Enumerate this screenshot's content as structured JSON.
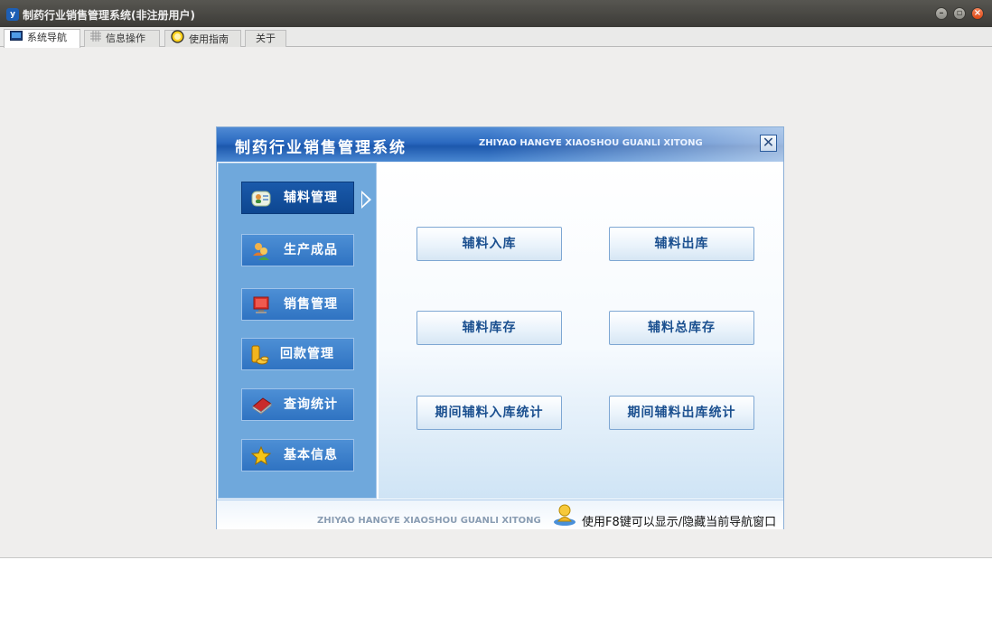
{
  "window": {
    "title": "制药行业销售管理系统(非注册用户)",
    "app_icon_text": "y",
    "controls": [
      "minimize",
      "maximize",
      "close"
    ]
  },
  "tabs": [
    {
      "label": "系统导航",
      "icon": "monitor-icon",
      "active": true
    },
    {
      "label": "信息操作",
      "icon": "grid-icon",
      "active": false
    },
    {
      "label": "使用指南",
      "icon": "help-circle-icon",
      "active": false
    },
    {
      "label": "关于",
      "icon": "",
      "active": false
    }
  ],
  "nav": {
    "title": "制药行业销售管理系统",
    "subtitle": "ZHIYAO HANGYE XIAOSHOU GUANLI XITONG",
    "close_glyph": "✕",
    "sidebar": [
      {
        "label": "辅料管理",
        "icon": "users-card-icon",
        "active": true
      },
      {
        "label": "生产成品",
        "icon": "people-icon",
        "active": false
      },
      {
        "label": "销售管理",
        "icon": "monitor-red-icon",
        "active": false
      },
      {
        "label": "回款管理",
        "icon": "coins-icon",
        "active": false
      },
      {
        "label": "查询统计",
        "icon": "book-icon",
        "active": false
      },
      {
        "label": "基本信息",
        "icon": "star-icon",
        "active": false
      }
    ],
    "functions": [
      "辅料入库",
      "辅料出库",
      "辅料库存",
      "辅料总库存",
      "期间辅料入库统计",
      "期间辅料出库统计"
    ],
    "footer_en": "ZHIYAO HANGYE XIAOSHOU GUANLI XITONG",
    "footer_tip": "使用F8键可以显示/隐藏当前导航窗口"
  },
  "colors": {
    "titlebar": "#3c3b37",
    "nav_header": "#2a69c0",
    "sidebar": "#6fa8dc",
    "button_text": "#1a4f8f"
  }
}
